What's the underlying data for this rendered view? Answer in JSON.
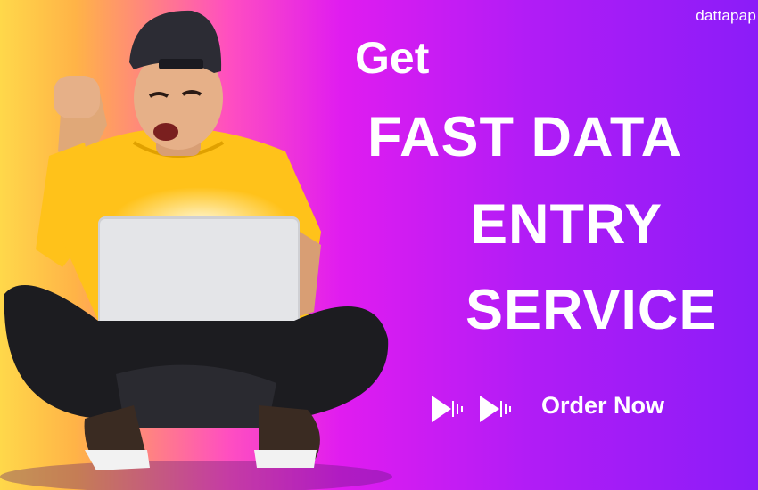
{
  "brand": {
    "name": "dattapap"
  },
  "headline": {
    "line1": "Get",
    "line2": "FAST DATA",
    "line3": "ENTRY",
    "line4": "SERVICE"
  },
  "cta": {
    "label": "Order Now",
    "icon": "play-arrows-icon"
  },
  "illustration": {
    "subject": "man-with-laptop-photo"
  },
  "colors": {
    "gradient_left": "#ffd84a",
    "gradient_middle": "#e01cf0",
    "gradient_right": "#8b1cf8",
    "text": "#ffffff",
    "shirt": "#ffc21a"
  }
}
